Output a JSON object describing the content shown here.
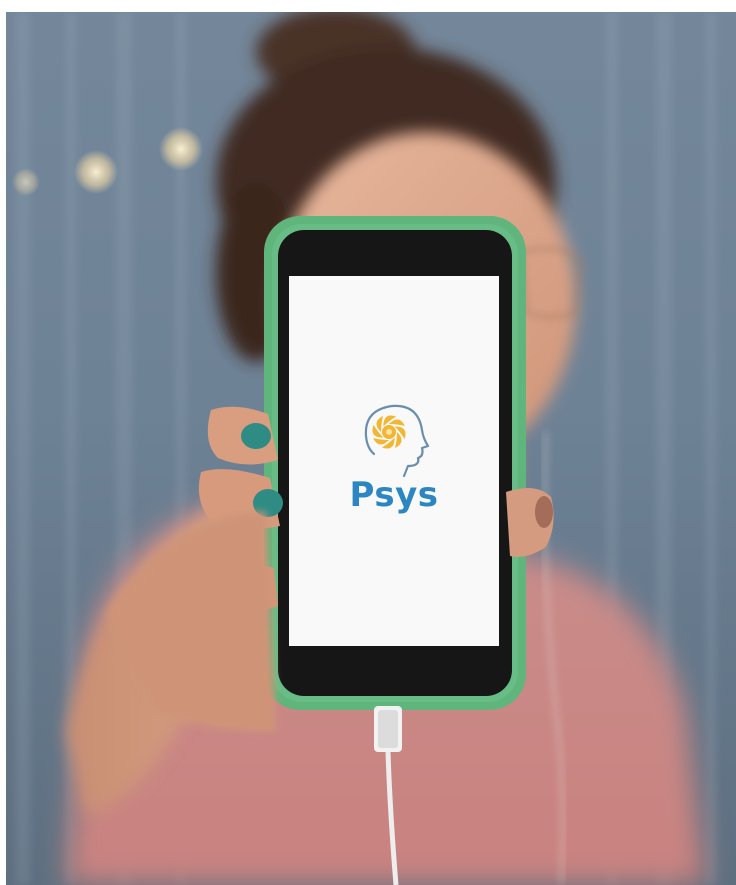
{
  "app": {
    "name": "Psys",
    "brand_color": "#2c86c2",
    "logo_accent_color": "#f2b632",
    "logo_outline_color": "#6a8fae",
    "icon": "brain-head-icon"
  },
  "phone": {
    "case_color": "#5fb57c",
    "screen_color": "#f9f9f9"
  }
}
